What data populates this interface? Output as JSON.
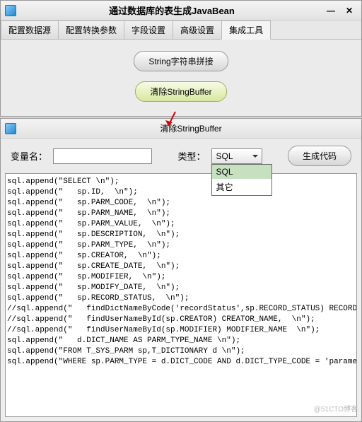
{
  "main_window": {
    "title": "通过数据库的表生成JavaBean",
    "minimize": "—",
    "close": "✕"
  },
  "tabs": [
    "配置数据源",
    "配置转换参数",
    "字段设置",
    "高级设置",
    "集成工具"
  ],
  "active_tab": 4,
  "buttons": {
    "string_concat": "String字符串拼接",
    "clear_buffer": "清除StringBuffer"
  },
  "sub_window": {
    "title": "清除StringBuffer"
  },
  "toolbar": {
    "var_label": "变量名：",
    "var_value": "",
    "type_label": "类型：",
    "type_selected": "SQL",
    "type_options": [
      "SQL",
      "其它"
    ],
    "gen_code": "生成代码"
  },
  "code": "sql.append(\"SELECT \\n\");\nsql.append(\"   sp.ID,  \\n\");\nsql.append(\"   sp.PARM_CODE,  \\n\");\nsql.append(\"   sp.PARM_NAME,  \\n\");\nsql.append(\"   sp.PARM_VALUE,  \\n\");\nsql.append(\"   sp.DESCRIPTION,  \\n\");\nsql.append(\"   sp.PARM_TYPE,  \\n\");\nsql.append(\"   sp.CREATOR,  \\n\");\nsql.append(\"   sp.CREATE_DATE,  \\n\");\nsql.append(\"   sp.MODIFIER,  \\n\");\nsql.append(\"   sp.MODIFY_DATE,  \\n\");\nsql.append(\"   sp.RECORD_STATUS,  \\n\");\n//sql.append(\"   findDictNameByCode('recordStatus',sp.RECORD_STATUS) RECORD_STATUS\n//sql.append(\"   findUserNameById(sp.CREATOR) CREATOR_NAME,  \\n\");\n//sql.append(\"   findUserNameById(sp.MODIFIER) MODIFIER_NAME  \\n\");\nsql.append(\"   d.DICT_NAME AS PARM_TYPE_NAME \\n\");\nsql.append(\"FROM T_SYS_PARM sp,T_DICTIONARY d \\n\");\nsql.append(\"WHERE sp.PARM_TYPE = d.DICT_CODE AND d.DICT_TYPE_CODE = 'parameterTyp",
  "watermark": "@51CTO博客"
}
